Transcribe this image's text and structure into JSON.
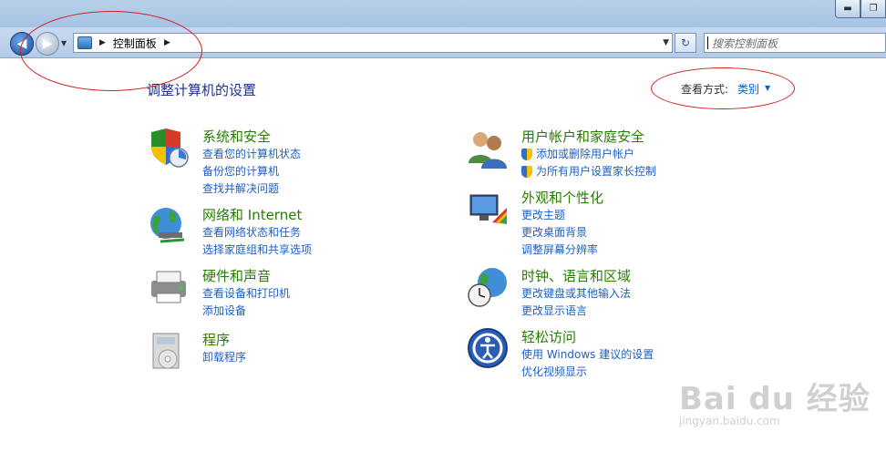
{
  "window": {
    "minimize_glyph": "▬",
    "maximize_glyph": "❐"
  },
  "nav": {
    "back_glyph": "◀",
    "forward_glyph": "▶",
    "history_glyph": "▼",
    "breadcrumb": [
      "控制面板"
    ],
    "sep_glyph": "▶",
    "dropdown_glyph": "▼",
    "refresh_glyph": "↻",
    "search_placeholder": "搜索控制面板"
  },
  "content": {
    "page_title": "调整计算机的设置",
    "view_by_label": "查看方式:",
    "view_by_value": "类别",
    "view_by_arrow": "▼"
  },
  "categories": [
    {
      "title": "系统和安全",
      "icon": "system-security-icon",
      "links": [
        "查看您的计算机状态",
        "备份您的计算机",
        "查找并解决问题"
      ]
    },
    {
      "title": "网络和 Internet",
      "icon": "network-icon",
      "links": [
        "查看网络状态和任务",
        "选择家庭组和共享选项"
      ]
    },
    {
      "title": "硬件和声音",
      "icon": "hardware-sound-icon",
      "links": [
        "查看设备和打印机",
        "添加设备"
      ]
    },
    {
      "title": "程序",
      "icon": "programs-icon",
      "links": [
        "卸载程序"
      ]
    },
    {
      "title": "用户帐户和家庭安全",
      "icon": "user-accounts-icon",
      "links": [
        "添加或删除用户帐户",
        "为所有用户设置家长控制"
      ]
    },
    {
      "title": "外观和个性化",
      "icon": "appearance-icon",
      "links": [
        "更改主题",
        "更改桌面背景",
        "调整屏幕分辨率"
      ]
    },
    {
      "title": "时钟、语言和区域",
      "icon": "clock-language-icon",
      "links": [
        "更改键盘或其他输入法",
        "更改显示语言"
      ]
    },
    {
      "title": "轻松访问",
      "icon": "ease-of-access-icon",
      "links": [
        "使用 Windows 建议的设置",
        "优化视频显示"
      ]
    }
  ],
  "watermark": {
    "logo": "Bai du 经验",
    "url": "jingyan.baidu.com"
  }
}
